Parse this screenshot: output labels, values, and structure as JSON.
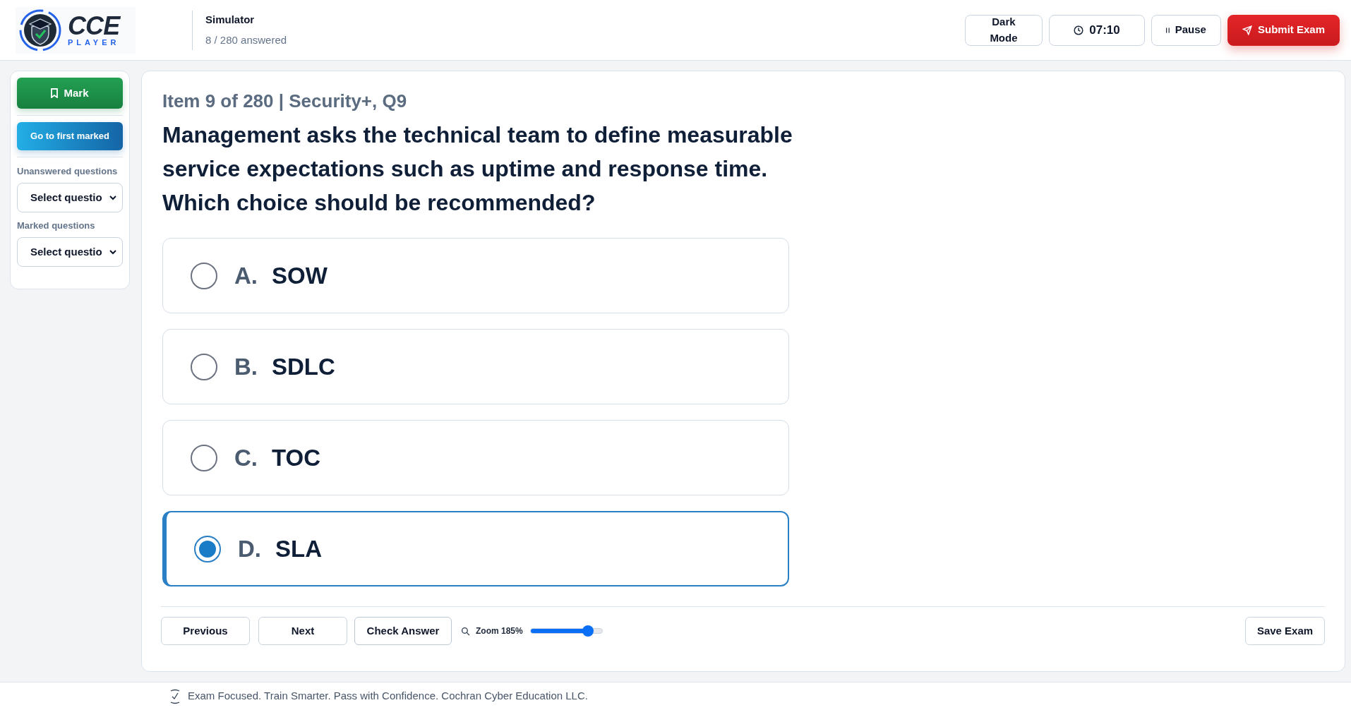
{
  "header": {
    "logo": {
      "title": "CCE",
      "subtitle": "PLAYER"
    },
    "mode": "Simulator",
    "progress": "8 / 280 answered",
    "buttons": [
      {
        "kind": "plain",
        "label": "Dark Mode"
      },
      {
        "kind": "timer",
        "label": "07:10"
      },
      {
        "kind": "pause",
        "label": "Pause"
      },
      {
        "kind": "submit",
        "label": "Submit Exam"
      }
    ]
  },
  "sidebar": {
    "mark_button": "Mark",
    "first_marked_button": "Go to first marked",
    "filters": [
      {
        "label": "Unanswered questions",
        "value": "Select questio"
      },
      {
        "label": "Marked questions",
        "value": "Select questio"
      }
    ]
  },
  "question": {
    "heading": "Item 9 of 280 | Security+, Q9",
    "text": "Management asks the technical team to define measurable service expectations such as uptime and response time. Which choice should be recommended?",
    "options": [
      {
        "letter": "A.",
        "text": "SOW",
        "selected": false
      },
      {
        "letter": "B.",
        "text": "SDLC",
        "selected": false
      },
      {
        "letter": "C.",
        "text": "TOC",
        "selected": false
      },
      {
        "letter": "D.",
        "text": "SLA",
        "selected": true
      }
    ]
  },
  "toolbar": {
    "previous": "Previous",
    "next": "Next",
    "check": "Check Answer",
    "zoom": {
      "label": "Zoom 185%",
      "level": 0.8
    },
    "save": "Save Exam"
  },
  "footer": {
    "text": "Exam Focused. Train Smarter. Pass with Confidence. Cochran Cyber Education LLC."
  }
}
